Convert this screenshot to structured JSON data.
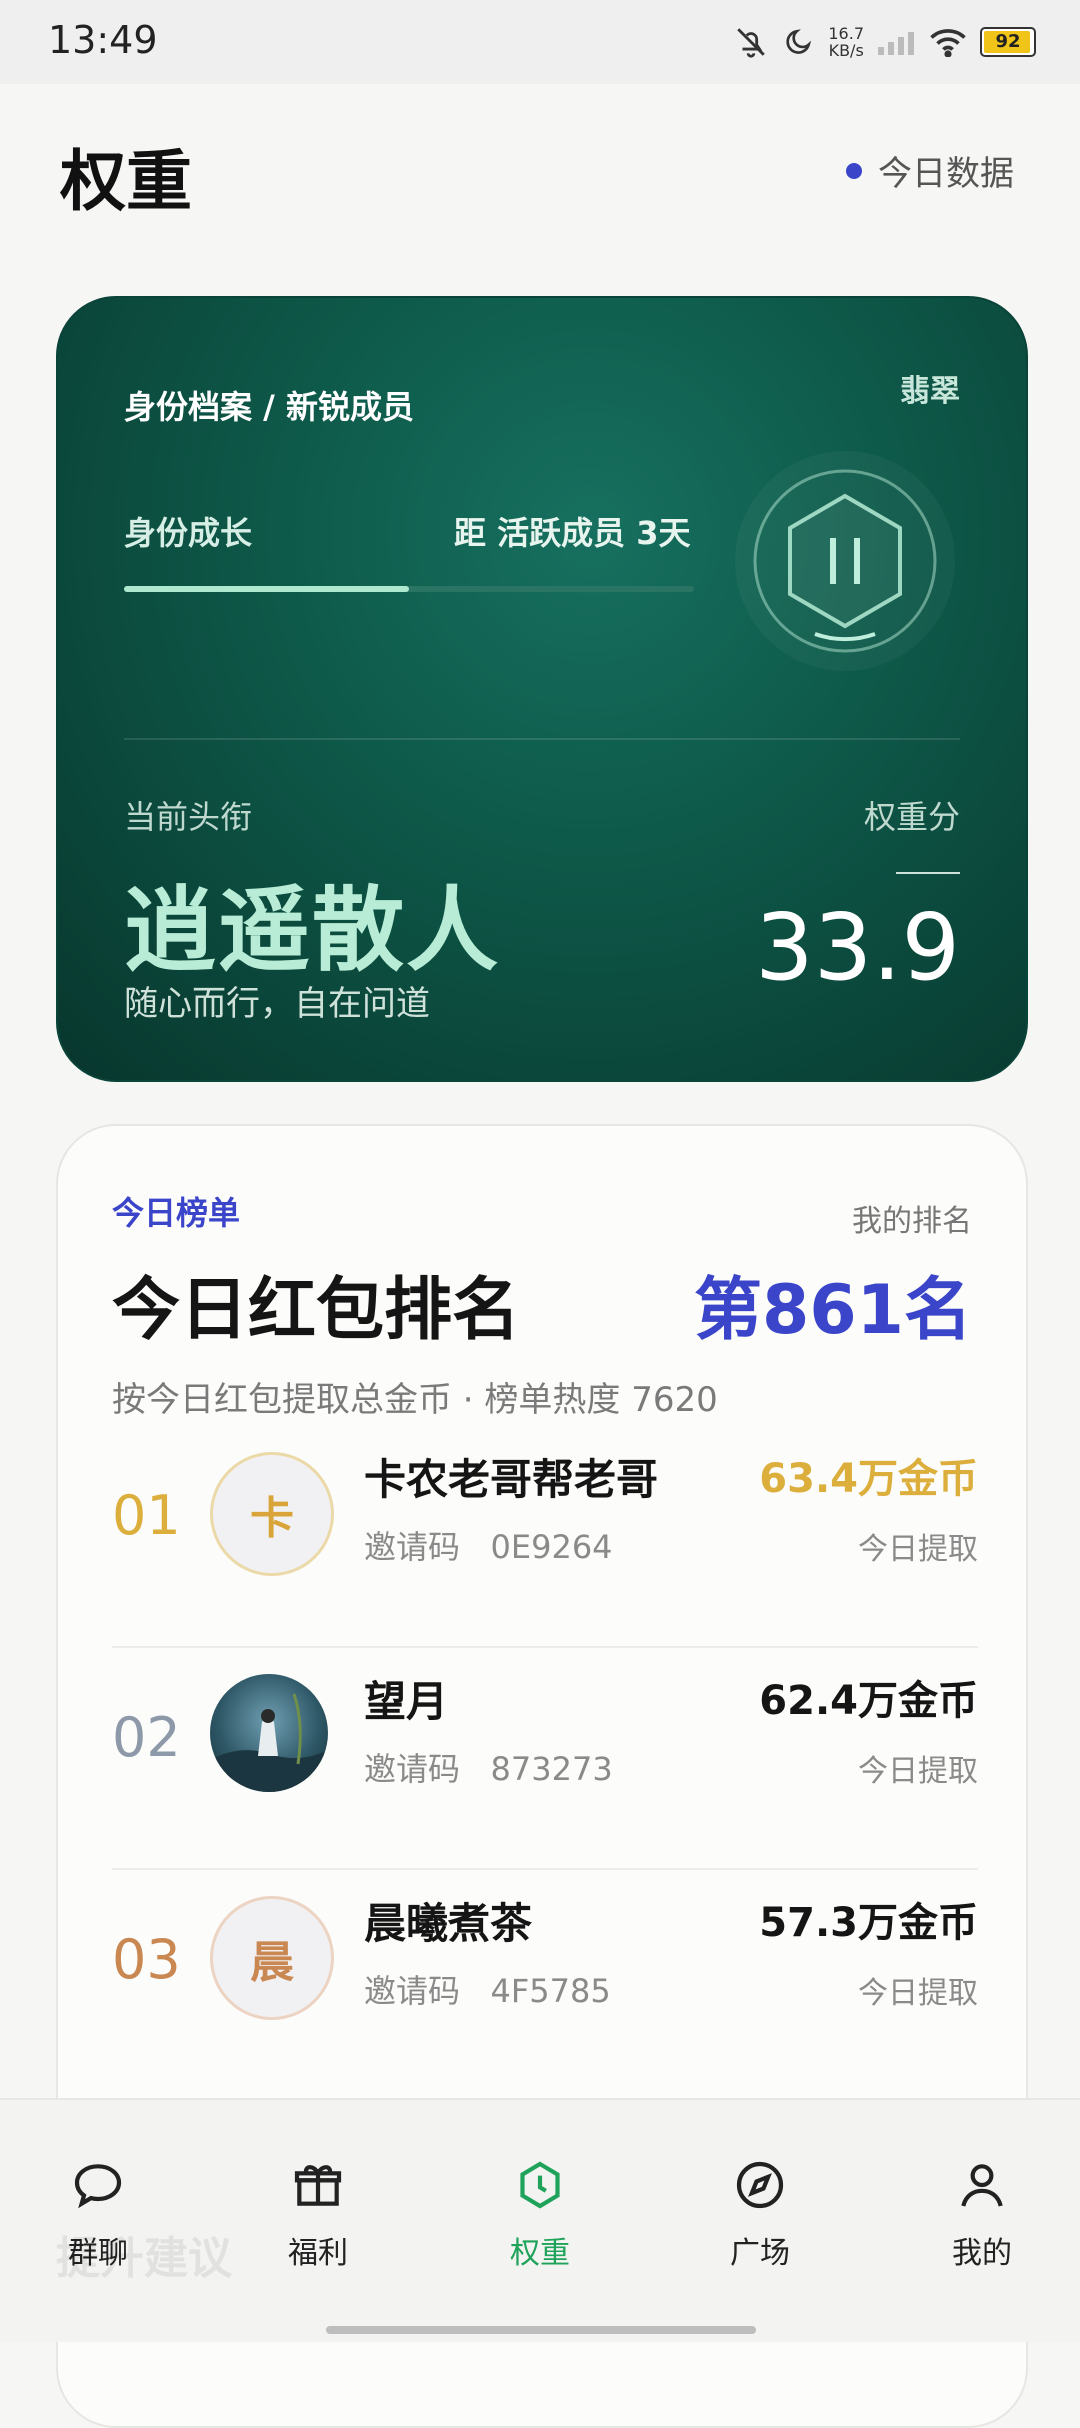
{
  "status_bar": {
    "time": "13:49",
    "net_speed": "16.7",
    "net_unit": "KB/s",
    "battery": "92"
  },
  "header": {
    "title": "权重",
    "today_data_label": "今日数据"
  },
  "identity_card": {
    "breadcrumb": "身份档案 / 新锐成员",
    "badge": "翡翠",
    "growth_label": "身份成长",
    "next_level_text": "距 活跃成员 3天",
    "progress_fraction": 0.5,
    "current_title_label": "当前头衔",
    "current_title": "逍遥散人",
    "motto": "随心而行，自在问道",
    "weight_label": "权重分",
    "weight_value": "33.9"
  },
  "ranking": {
    "kicker": "今日榜单",
    "my_rank_label": "我的排名",
    "title": "今日红包排名",
    "my_rank": "第861名",
    "subtitle": "按今日红包提取总金币 · 榜单热度 7620",
    "rows": [
      {
        "rank": "01",
        "avatar_text": "卡",
        "name": "卡农老哥帮老哥",
        "invite": "邀请码   0E9264",
        "coins": "63.4万金币",
        "action": "今日提取",
        "rank_color": "#dcae3c",
        "coins_color": "#dcae3c"
      },
      {
        "rank": "02",
        "avatar_text": "",
        "name": "望月",
        "invite": "邀请码   873273",
        "coins": "62.4万金币",
        "action": "今日提取",
        "rank_color": "#8d99a8",
        "coins_color": "#151515"
      },
      {
        "rank": "03",
        "avatar_text": "晨",
        "name": "晨曦煮茶",
        "invite": "邀请码   4F5785",
        "coins": "57.3万金币",
        "action": "今日提取",
        "rank_color": "#c98752",
        "coins_color": "#151515"
      }
    ]
  },
  "faded_text": "提升建议",
  "nav": [
    {
      "label": "群聊",
      "icon": "chat-icon"
    },
    {
      "label": "福利",
      "icon": "gift-icon"
    },
    {
      "label": "权重",
      "icon": "weight-icon"
    },
    {
      "label": "广场",
      "icon": "compass-icon"
    },
    {
      "label": "我的",
      "icon": "user-icon"
    }
  ]
}
